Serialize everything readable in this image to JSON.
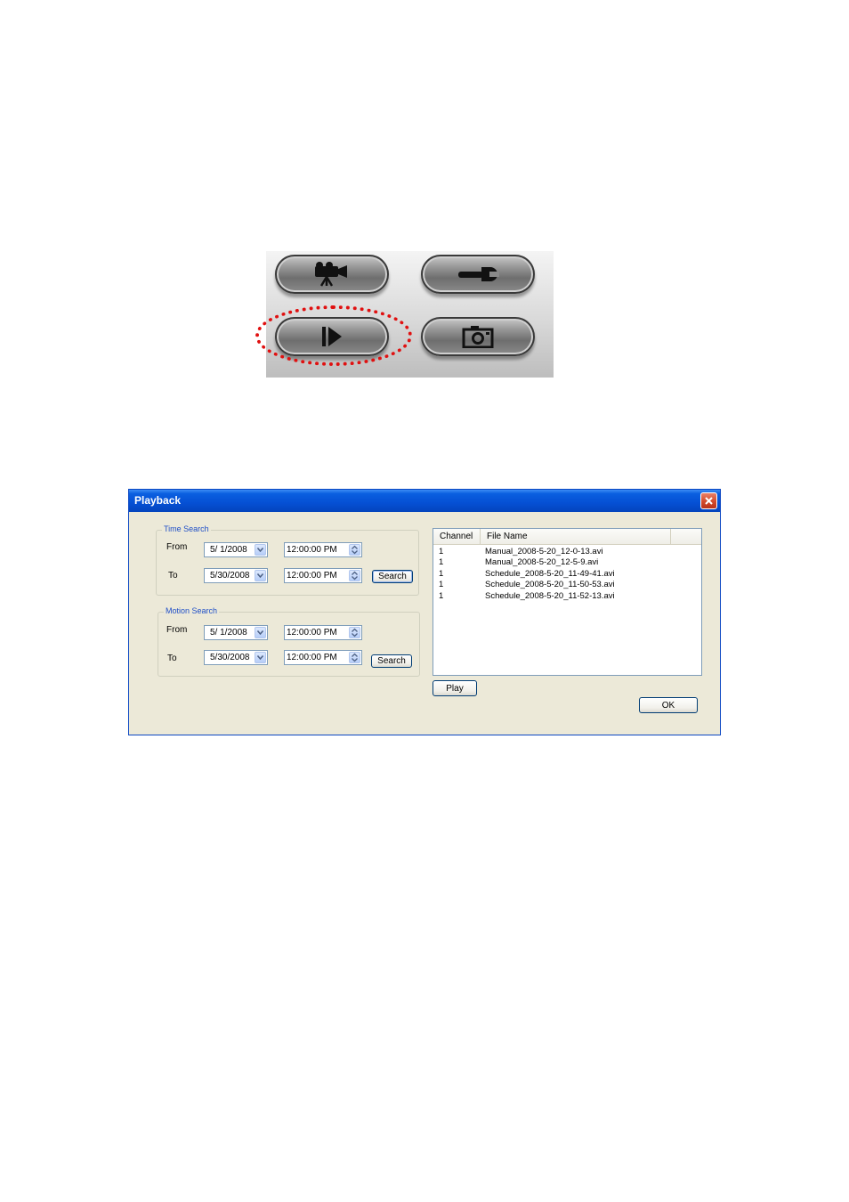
{
  "toolbar": {
    "buttons": [
      {
        "name": "camera",
        "icon": "video-camera-icon"
      },
      {
        "name": "settings",
        "icon": "wrench-icon"
      },
      {
        "name": "playback",
        "icon": "play-icon",
        "highlighted": true
      },
      {
        "name": "snapshot",
        "icon": "camera-snapshot-icon"
      }
    ],
    "highlight_color": "#e01010"
  },
  "dialog": {
    "title": "Playback",
    "close_icon": "close-icon",
    "time_search": {
      "legend": "Time Search",
      "from_label": "From",
      "to_label": "To",
      "from_date": "5/ 1/2008",
      "from_time": "12:00:00 PM",
      "to_date": "5/30/2008",
      "to_time": "12:00:00 PM",
      "search_label": "Search"
    },
    "motion_search": {
      "legend": "Motion Search",
      "from_label": "From",
      "to_label": "To",
      "from_date": "5/ 1/2008",
      "from_time": "12:00:00 PM",
      "to_date": "5/30/2008",
      "to_time": "12:00:00 PM",
      "search_label": "Search"
    },
    "file_list": {
      "columns": [
        "Channel",
        "File Name"
      ],
      "rows": [
        {
          "channel": "1",
          "file": "Manual_2008-5-20_12-0-13.avi"
        },
        {
          "channel": "1",
          "file": "Manual_2008-5-20_12-5-9.avi"
        },
        {
          "channel": "1",
          "file": "Schedule_2008-5-20_11-49-41.avi"
        },
        {
          "channel": "1",
          "file": "Schedule_2008-5-20_11-50-53.avi"
        },
        {
          "channel": "1",
          "file": "Schedule_2008-5-20_11-52-13.avi"
        }
      ]
    },
    "play_label": "Play",
    "ok_label": "OK"
  },
  "colors": {
    "titlebar": "#0550d4",
    "dialog_bg": "#ece9d8",
    "legend_text": "#1f4fc7",
    "close_button": "#d24a2a"
  }
}
